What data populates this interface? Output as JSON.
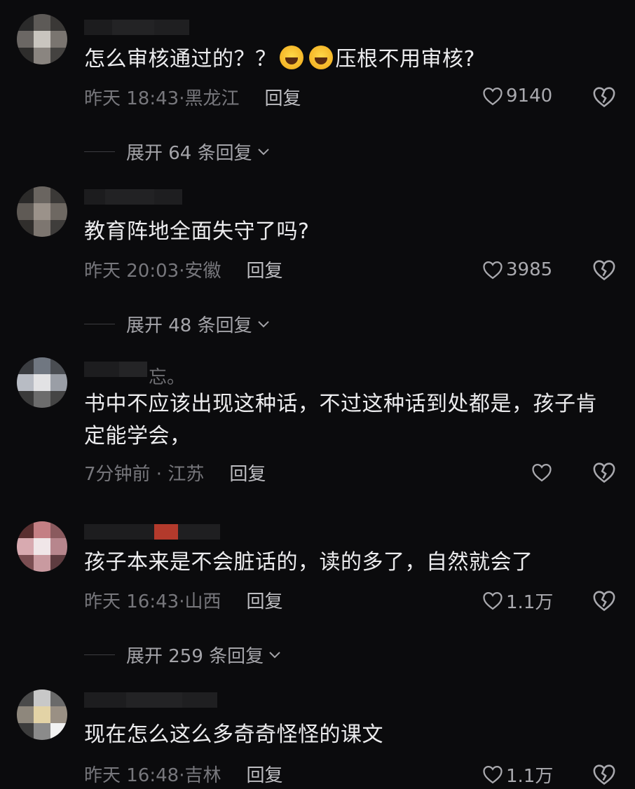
{
  "comments": [
    {
      "text_before": "怎么审核通过的？？",
      "text_after": "压根不用审核?",
      "emojis": [
        "laughing-crying-emoji",
        "laughing-crying-emoji"
      ],
      "time": "昨天 18:43",
      "location": "黑龙江",
      "reply_label": "回复",
      "likes": "9140",
      "expand_label": "展开 64 条回复"
    },
    {
      "text": "教育阵地全面失守了吗?",
      "time": "昨天 20:03",
      "location": "安徽",
      "reply_label": "回复",
      "likes": "3985",
      "expand_label": "展开 48 条回复"
    },
    {
      "name_tail": "忘。",
      "text": "书中不应该出现这种话，不过这种话到处都是，孩子肯定能学会，",
      "time": "7分钟前",
      "location": "江苏",
      "reply_label": "回复",
      "likes": ""
    },
    {
      "text": "孩子本来是不会脏话的，读的多了，自然就会了",
      "time": "昨天 16:43",
      "location": "山西",
      "reply_label": "回复",
      "likes": "1.1万",
      "expand_label": "展开 259 条回复"
    },
    {
      "text": "现在怎么这么多奇奇怪怪的课文",
      "time": "昨天 16:48",
      "location": "吉林",
      "reply_label": "回复",
      "likes": "1.1万"
    }
  ],
  "icons": {
    "like": "heart-outline-icon",
    "dislike": "broken-heart-icon",
    "expand": "chevron-down-icon"
  },
  "colors": {
    "background": "#0b0b0d",
    "text": "#ececee",
    "meta": "#77777c",
    "reply": "#bdbdc1"
  }
}
